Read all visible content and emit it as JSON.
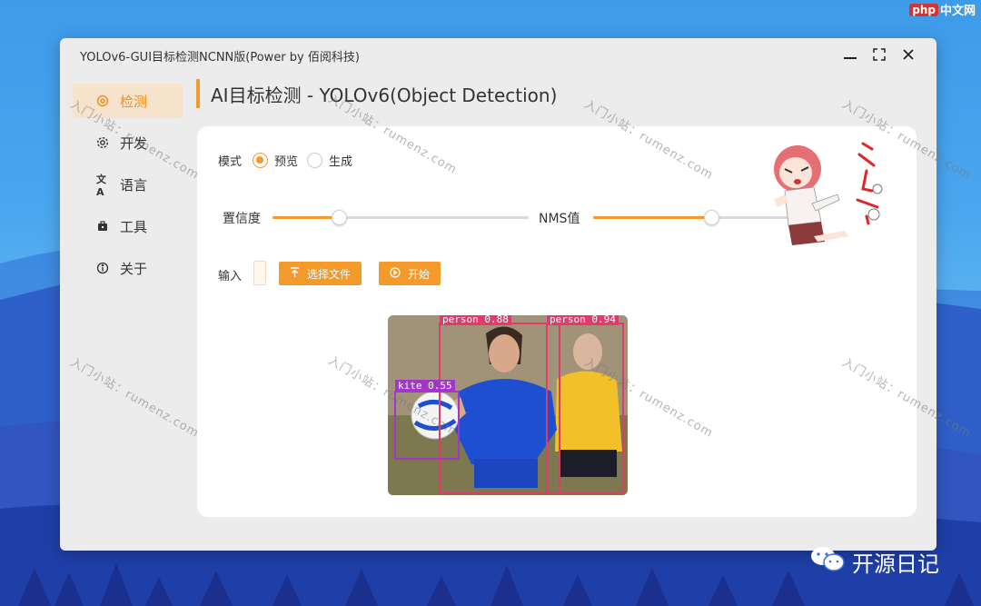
{
  "window": {
    "title": "YOLOv6-GUI目标检测NCNN版(Power by 佰阅科技)",
    "controls": [
      "minimize-icon",
      "maximize-icon",
      "close-icon"
    ]
  },
  "sidebar": {
    "items": [
      {
        "label": "检测",
        "icon": "detect-icon",
        "active": true
      },
      {
        "label": "开发",
        "icon": "gear-icon",
        "active": false
      },
      {
        "label": "语言",
        "icon": "translate-icon",
        "active": false
      },
      {
        "label": "工具",
        "icon": "toolbox-icon",
        "active": false
      },
      {
        "label": "关于",
        "icon": "info-icon",
        "active": false
      }
    ]
  },
  "header": {
    "title": "AI目标检测 - YOLOv6(Object Detection)"
  },
  "mode": {
    "label": "模式",
    "options": [
      {
        "label": "预览",
        "checked": true
      },
      {
        "label": "生成",
        "checked": false
      }
    ]
  },
  "confidence": {
    "label": "置信度",
    "value": 0.26
  },
  "nms": {
    "label": "NMS值",
    "value": 0.55
  },
  "input": {
    "label": "输入",
    "value": "",
    "select_button": "选择文件",
    "start_button": "开始"
  },
  "detections": [
    {
      "label": "person 0.88",
      "color": "#e23a6a"
    },
    {
      "label": "person 0.94",
      "color": "#e23a6a"
    },
    {
      "label": "kite 0.55",
      "color": "#a236c8"
    }
  ],
  "watermark": "入门小站：rumenz.com",
  "overlay": {
    "php_badge": "php",
    "php_text": "中文网",
    "brand": "开源日记"
  },
  "colors": {
    "accent": "#f39a2a",
    "active_bg": "#f5e3cc",
    "detect_box": "#e23a6a",
    "kite_box": "#a236c8"
  }
}
